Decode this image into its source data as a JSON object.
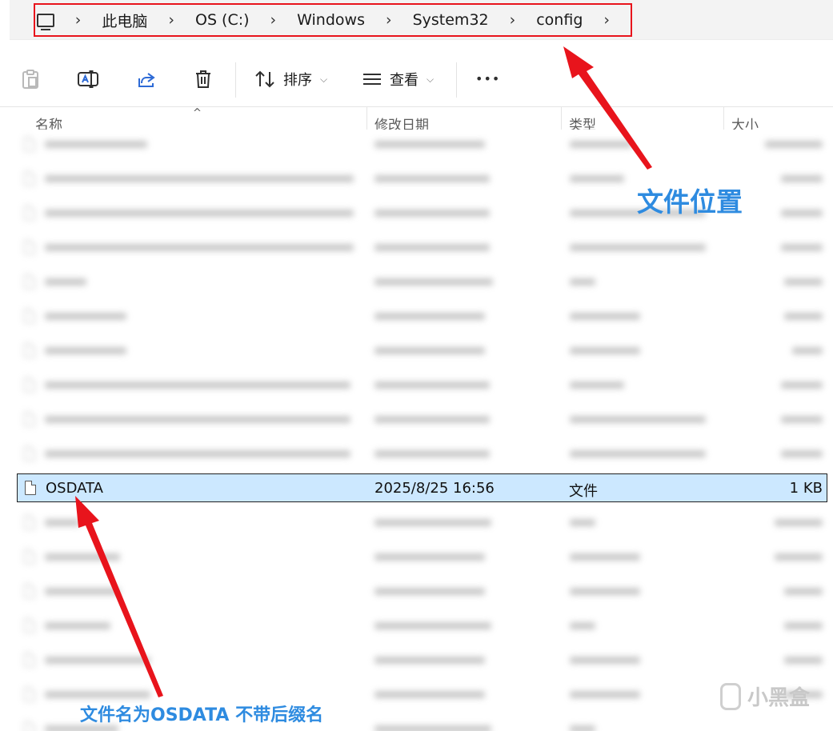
{
  "address_bar": {
    "crumbs": [
      "此电脑",
      "OS (C:)",
      "Windows",
      "System32",
      "config"
    ],
    "separator": "›"
  },
  "toolbar": {
    "sort_label": "排序",
    "view_label": "查看",
    "more_label": "•••",
    "icons": [
      "paste-icon",
      "rename-icon",
      "share-icon",
      "delete-icon",
      "sort-icon",
      "view-icon",
      "more-icon"
    ]
  },
  "columns": {
    "name": "名称",
    "modified": "修改日期",
    "type": "类型",
    "size": "大小"
  },
  "selected_file": {
    "name": "OSDATA",
    "modified": "2025/8/25 16:56",
    "type": "文件",
    "size": "1 KB"
  },
  "annotations": {
    "location": "文件位置",
    "file_name": "文件名为OSDATA 不带后缀名",
    "arrow_color": "#e8141c",
    "text_color": "#2e8be0"
  },
  "watermark": "小黑盒",
  "colors": {
    "selection": "#cce8ff",
    "highlight_box": "#e8141c"
  }
}
